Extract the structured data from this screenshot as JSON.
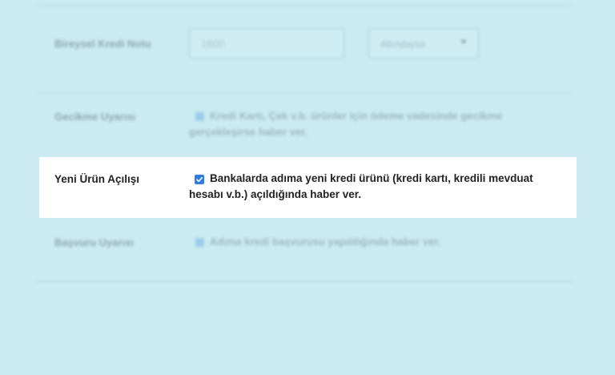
{
  "rows": {
    "credit_score": {
      "label": "Bireysel Kredi Notu",
      "input_value": "1600",
      "select_value": "Altındaysa",
      "select_icon": "chevron-down-icon"
    },
    "late_warning": {
      "label": "Gecikme Uyarısı",
      "checked": true,
      "text": "Kredi Kartı, Çek v.b. ürünler için ödeme vadesinde gecikme gerçekleşirse haber ver."
    },
    "new_product": {
      "label": "Yeni Ürün Açılışı",
      "checked": true,
      "text": "Bankalarda adıma yeni kredi ürünü (kredi kartı, kredili mevduat hesabı v.b.) açıldığında haber ver."
    },
    "application_warning": {
      "label": "Başvuru Uyarısı",
      "checked": true,
      "text": "Adıma kredi başvurusu yapıldığında haber ver."
    }
  },
  "colors": {
    "background": "#cbeaf2",
    "card": "#ffffff",
    "checkbox_active": "#2f7de1",
    "checkbox_blurred": "#9ccbeb"
  }
}
